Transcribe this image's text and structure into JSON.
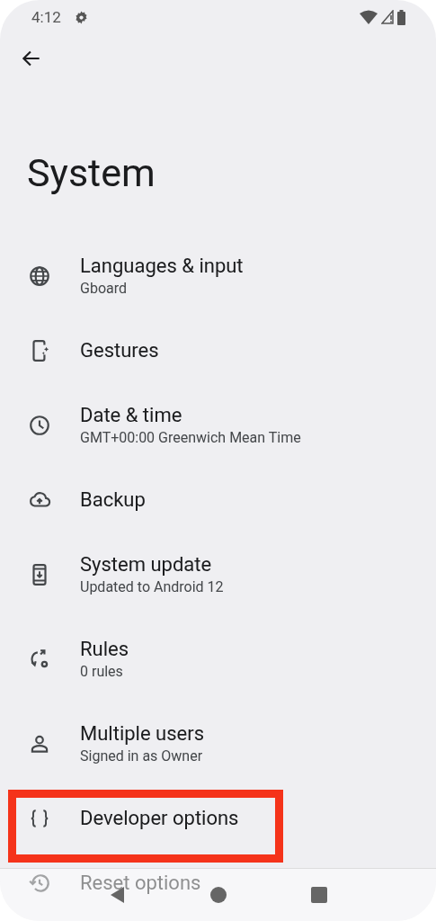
{
  "status_bar": {
    "time": "4:12"
  },
  "title": "System",
  "items": [
    {
      "title": "Languages & input",
      "subtitle": "Gboard",
      "highlighted": false
    },
    {
      "title": "Gestures",
      "highlighted": false
    },
    {
      "title": "Date & time",
      "subtitle": "GMT+00:00 Greenwich Mean Time",
      "highlighted": false
    },
    {
      "title": "Backup",
      "highlighted": false
    },
    {
      "title": "System update",
      "subtitle": "Updated to Android 12",
      "highlighted": false
    },
    {
      "title": "Rules",
      "subtitle": "0 rules",
      "highlighted": false
    },
    {
      "title": "Multiple users",
      "subtitle": "Signed in as Owner",
      "highlighted": false
    },
    {
      "title": "Developer options",
      "highlighted": true
    },
    {
      "title": "Reset options",
      "highlighted": false
    }
  ]
}
